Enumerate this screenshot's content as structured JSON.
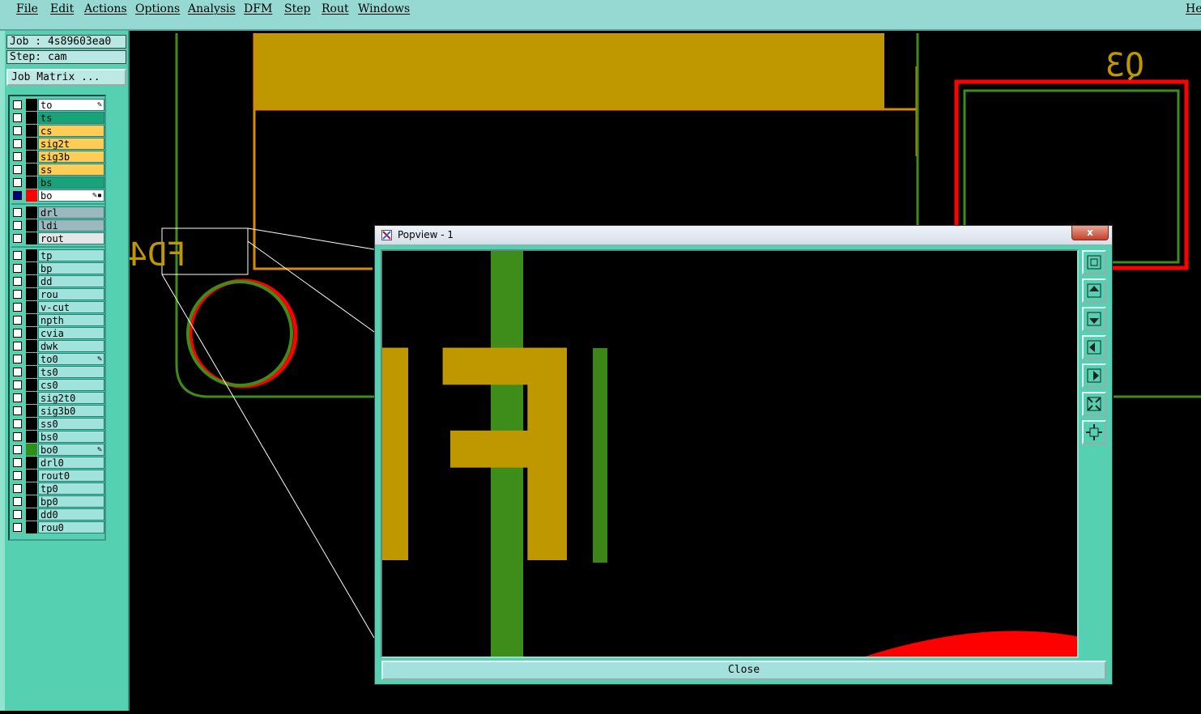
{
  "menu": {
    "items": [
      "File",
      "Edit",
      "Actions",
      "Options",
      "Analysis",
      "DFM",
      "Step",
      "Rout",
      "Windows"
    ],
    "help": "He"
  },
  "left_panel": {
    "job": "Job : 4s89603ea0",
    "step": "Step: cam",
    "job_matrix_button": "Job Matrix ..."
  },
  "layers": {
    "board": [
      {
        "name": "to",
        "color": "#ffffff",
        "swatch": "#000000",
        "mark": "✎"
      },
      {
        "name": "ts",
        "color": "#1aa37a",
        "swatch": "#000000",
        "mark": ""
      },
      {
        "name": "cs",
        "color": "#ffcc55",
        "swatch": "#000000",
        "mark": ""
      },
      {
        "name": "sig2t",
        "color": "#ffcc55",
        "swatch": "#000000",
        "mark": ""
      },
      {
        "name": "sig3b",
        "color": "#ffcc55",
        "swatch": "#000000",
        "mark": ""
      },
      {
        "name": "ss",
        "color": "#ffcc55",
        "swatch": "#000000",
        "mark": ""
      },
      {
        "name": "bs",
        "color": "#1aa37a",
        "swatch": "#000000",
        "mark": ""
      },
      {
        "name": "bo",
        "color": "#ffffff",
        "swatch": "#ff0000",
        "mark": "✎▪",
        "checked": true
      }
    ],
    "drill": [
      {
        "name": "drl",
        "color": "#9ab8be",
        "swatch": "#000000",
        "mark": ""
      },
      {
        "name": "ldi",
        "color": "#9ab8be",
        "swatch": "#000000",
        "mark": ""
      },
      {
        "name": "rout",
        "color": "#e6e6e6",
        "swatch": "#000000",
        "mark": ""
      }
    ],
    "misc": [
      {
        "name": "tp",
        "swatch": "#000000",
        "mark": ""
      },
      {
        "name": "bp",
        "swatch": "#000000",
        "mark": ""
      },
      {
        "name": "dd",
        "swatch": "#000000",
        "mark": ""
      },
      {
        "name": "rou",
        "swatch": "#000000",
        "mark": ""
      },
      {
        "name": "v-cut",
        "swatch": "#000000",
        "mark": ""
      },
      {
        "name": "npth",
        "swatch": "#000000",
        "mark": ""
      },
      {
        "name": "cvia",
        "swatch": "#000000",
        "mark": ""
      },
      {
        "name": "dwk",
        "swatch": "#000000",
        "mark": ""
      },
      {
        "name": "to0",
        "swatch": "#000000",
        "mark": "✎"
      },
      {
        "name": "ts0",
        "swatch": "#000000",
        "mark": ""
      },
      {
        "name": "cs0",
        "swatch": "#000000",
        "mark": ""
      },
      {
        "name": "sig2t0",
        "swatch": "#000000",
        "mark": ""
      },
      {
        "name": "sig3b0",
        "swatch": "#000000",
        "mark": ""
      },
      {
        "name": "ss0",
        "swatch": "#000000",
        "mark": ""
      },
      {
        "name": "bs0",
        "swatch": "#000000",
        "mark": ""
      },
      {
        "name": "bo0",
        "swatch": "#2f8f1a",
        "mark": "✎"
      },
      {
        "name": "drl0",
        "swatch": "#000000",
        "mark": ""
      },
      {
        "name": "rout0",
        "swatch": "#000000",
        "mark": ""
      },
      {
        "name": "tp0",
        "swatch": "#000000",
        "mark": ""
      },
      {
        "name": "bp0",
        "swatch": "#000000",
        "mark": ""
      },
      {
        "name": "dd0",
        "swatch": "#000000",
        "mark": ""
      },
      {
        "name": "rou0",
        "swatch": "#000000",
        "mark": ""
      }
    ],
    "misc_color": "#9fe3dc"
  },
  "canvas": {
    "silkscreen_label_q3": "Q3",
    "silkscreen_label_fd4": "FD4",
    "colors": {
      "silk": "#bf9800",
      "outline_green": "#3e8c1a",
      "outline_red": "#ff0000",
      "outline_orange": "#d98a00"
    }
  },
  "popview": {
    "title": "Popview - 1",
    "close_x": "x",
    "close_button": "Close",
    "zoom_text": "FD4",
    "tools": [
      "zoom-fit-icon",
      "move-up-icon",
      "move-down-icon",
      "move-left-icon",
      "move-right-icon",
      "zoom-in-icon",
      "zoom-out-icon"
    ]
  }
}
